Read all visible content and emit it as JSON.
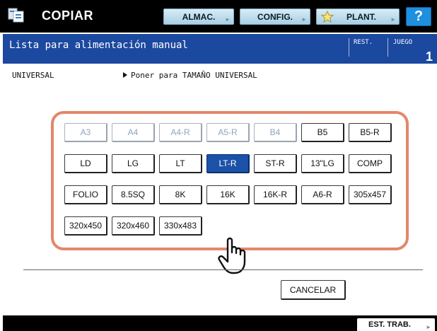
{
  "header": {
    "title": "COPIAR",
    "app_icon": "copy-icon",
    "buttons": [
      {
        "label": "ALMAC."
      },
      {
        "label": "CONFIG."
      },
      {
        "label": "PLANT.",
        "icon": "star-icon"
      }
    ],
    "help_label": "?"
  },
  "message_bar": {
    "message": "Lista para alimentación manual",
    "rest_label": "REST.",
    "juego_label": "JUEGO",
    "juego_value": "1"
  },
  "info": {
    "mode": "UNIVERSAL",
    "instruction": "Poner para TAMAÑO UNIVERSAL"
  },
  "sizes": {
    "row1": [
      {
        "label": "A3",
        "state": "disabled"
      },
      {
        "label": "A4",
        "state": "disabled"
      },
      {
        "label": "A4-R",
        "state": "disabled"
      },
      {
        "label": "A5-R",
        "state": "disabled"
      },
      {
        "label": "B4",
        "state": "disabled"
      },
      {
        "label": "B5",
        "state": "normal"
      },
      {
        "label": "B5-R",
        "state": "normal"
      }
    ],
    "row2": [
      {
        "label": "LD",
        "state": "normal"
      },
      {
        "label": "LG",
        "state": "normal"
      },
      {
        "label": "LT",
        "state": "normal"
      },
      {
        "label": "LT-R",
        "state": "selected"
      },
      {
        "label": "ST-R",
        "state": "normal"
      },
      {
        "label": "13\"LG",
        "state": "normal"
      },
      {
        "label": "COMP",
        "state": "normal"
      }
    ],
    "row3": [
      {
        "label": "FOLIO",
        "state": "normal"
      },
      {
        "label": "8.5SQ",
        "state": "normal"
      },
      {
        "label": "8K",
        "state": "normal"
      },
      {
        "label": "16K",
        "state": "normal"
      },
      {
        "label": "16K-R",
        "state": "normal"
      },
      {
        "label": "A6-R",
        "state": "normal"
      },
      {
        "label": "305x457",
        "state": "normal"
      }
    ],
    "row4": [
      {
        "label": "320x450",
        "state": "normal"
      },
      {
        "label": "320x460",
        "state": "normal"
      },
      {
        "label": "330x483",
        "state": "normal"
      }
    ]
  },
  "actions": {
    "cancel_label": "CANCELAR"
  },
  "footer": {
    "job_status_label": "EST. TRAB."
  },
  "colors": {
    "accent": "#1c49a0",
    "selected": "#1b52a8",
    "panel_border": "#e3876b",
    "help": "#1f8fe0"
  }
}
